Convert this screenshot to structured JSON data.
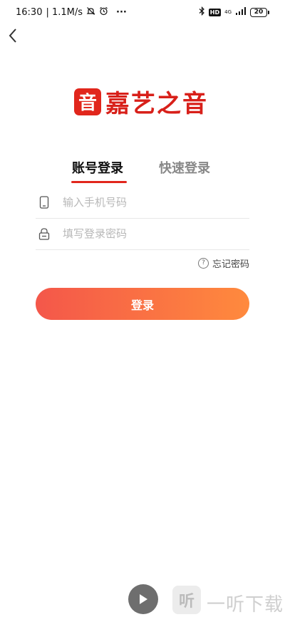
{
  "status_bar": {
    "time": "16:30",
    "speed": "| 1.1M/s",
    "more": "···",
    "hd": "HD",
    "network": "4G",
    "battery": "20"
  },
  "logo": {
    "mark_char": "音",
    "app_name": "嘉艺之音"
  },
  "tabs": {
    "account_login": "账号登录",
    "quick_login": "快速登录"
  },
  "form": {
    "phone_placeholder": "输入手机号码",
    "password_placeholder": "填写登录密码",
    "forgot_password": "忘记密码",
    "login_button": "登录"
  },
  "watermark": {
    "logo_char": "听",
    "text": "一听下载"
  },
  "colors": {
    "brand_red": "#e1261c",
    "button_gradient_start": "#f4574a",
    "button_gradient_end": "#ff8a3d"
  }
}
